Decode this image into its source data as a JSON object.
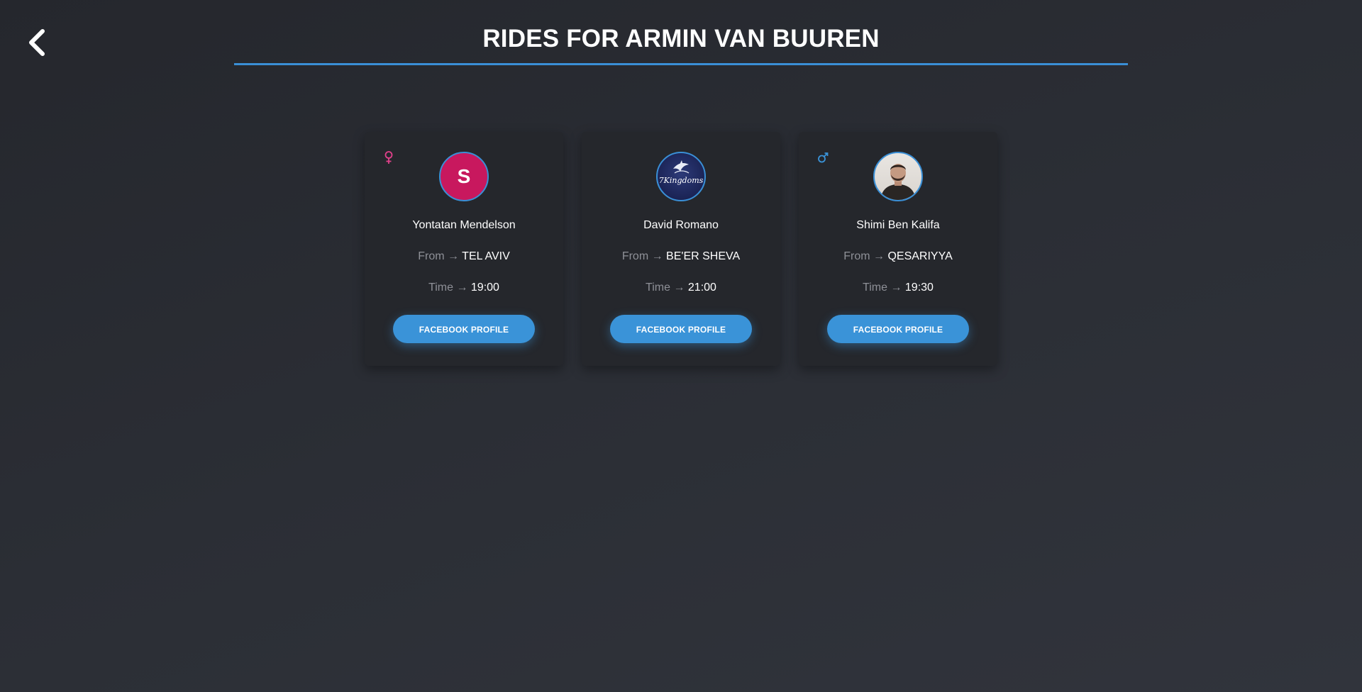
{
  "header": {
    "title": "RIDES FOR ARMIN VAN BUUREN",
    "accent_color": "#3a8fd6"
  },
  "back_button": {
    "icon": "chevron-left-icon"
  },
  "rides": [
    {
      "gender": "female",
      "gender_icon": "female-symbol-icon",
      "gender_color": "#e0408a",
      "avatar_type": "letter",
      "avatar_letter": "S",
      "avatar_color": "#c8185e",
      "name": "Yontatan Mendelson",
      "from_label": "From →",
      "from_value": "TEL AVIV",
      "time_label": "Time →",
      "time_value": "19:00",
      "button_label": "FACEBOOK PROFILE"
    },
    {
      "gender": "",
      "gender_icon": "",
      "avatar_type": "logo",
      "avatar_logo_text": "7Kingdoms",
      "name": "David Romano",
      "from_label": "From →",
      "from_value": "BE'ER SHEVA",
      "time_label": "Time →",
      "time_value": "21:00",
      "button_label": "FACEBOOK PROFILE"
    },
    {
      "gender": "male",
      "gender_icon": "male-symbol-icon",
      "gender_color": "#3a93d8",
      "avatar_type": "photo",
      "name": "Shimi Ben Kalifa",
      "from_label": "From →",
      "from_value": "QESARIYYA",
      "time_label": "Time →",
      "time_value": "19:30",
      "button_label": "FACEBOOK PROFILE"
    }
  ]
}
